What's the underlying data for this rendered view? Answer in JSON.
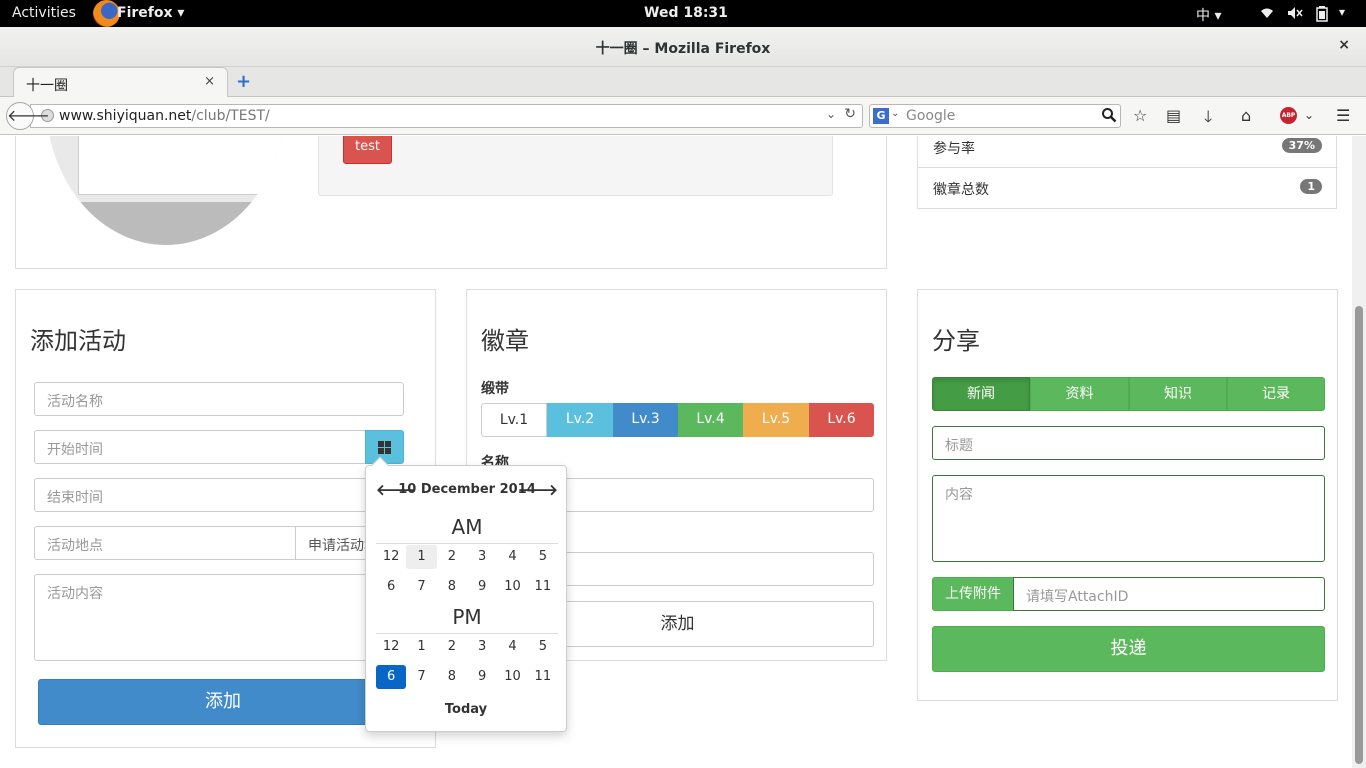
{
  "topbar": {
    "activities": "Activities",
    "app_menu": "Firefox",
    "app_menu_arrow": "▾",
    "clock": "Wed 18:31",
    "ime": "中 ▾",
    "icons": [
      "wifi-icon",
      "volume-icon",
      "battery-icon"
    ]
  },
  "window": {
    "title": "十一圈 – Mozilla Firefox",
    "close": "×"
  },
  "tabs": [
    {
      "label": "十一圈",
      "close": "×"
    }
  ],
  "new_tab": "+",
  "navbar": {
    "url_domain": "www.shiyiquan.net",
    "url_path": "/club/TEST/",
    "search_engine": "G",
    "search_placeholder": "Google"
  },
  "top_section": {
    "test_button": "test",
    "stats": [
      {
        "label": "参与率",
        "badge": "37%"
      },
      {
        "label": "徽章总数",
        "badge": "1"
      }
    ]
  },
  "add_activity": {
    "title": "添加活动",
    "name_placeholder": "活动名称",
    "start_placeholder": "开始时间",
    "end_placeholder": "结束时间",
    "location_placeholder": "活动地点",
    "apply_label": "申请活动地",
    "content_placeholder": "活动内容",
    "submit": "添加"
  },
  "badge_panel": {
    "title": "徽章",
    "ribbon_label": "缎带",
    "levels": [
      {
        "label": "Lv.1",
        "color": "#ffffff",
        "text": "#333333"
      },
      {
        "label": "Lv.2",
        "color": "#5bc0de",
        "text": "#ffffff"
      },
      {
        "label": "Lv.3",
        "color": "#428bca",
        "text": "#ffffff"
      },
      {
        "label": "Lv.4",
        "color": "#5cb85c",
        "text": "#ffffff"
      },
      {
        "label": "Lv.5",
        "color": "#f0ad4e",
        "text": "#ffffff"
      },
      {
        "label": "Lv.6",
        "color": "#d9534f",
        "text": "#ffffff"
      }
    ],
    "name_label": "名称",
    "submit": "添加"
  },
  "share_panel": {
    "title": "分享",
    "tabs": [
      "新闻",
      "资料",
      "知识",
      "记录"
    ],
    "active_tab": "新闻",
    "title_placeholder": "标题",
    "content_placeholder": "内容",
    "attach_button": "上传附件",
    "attach_placeholder": "请填写AttachID",
    "submit": "投递"
  },
  "datepicker": {
    "prev": "🡐",
    "next": "🡒",
    "heading": "10 December 2014",
    "am_label": "AM",
    "pm_label": "PM",
    "am_hours": [
      "12",
      "1",
      "2",
      "3",
      "4",
      "5",
      "6",
      "7",
      "8",
      "9",
      "10",
      "11"
    ],
    "pm_hours": [
      "12",
      "1",
      "2",
      "3",
      "4",
      "5",
      "6",
      "7",
      "8",
      "9",
      "10",
      "11"
    ],
    "hovered": "1",
    "selected": "6",
    "today": "Today"
  },
  "colors": {
    "primary": "#428bca",
    "success": "#5cb85c",
    "success_dark": "#449d44",
    "danger": "#d9534f",
    "info": "#5bc0de"
  }
}
